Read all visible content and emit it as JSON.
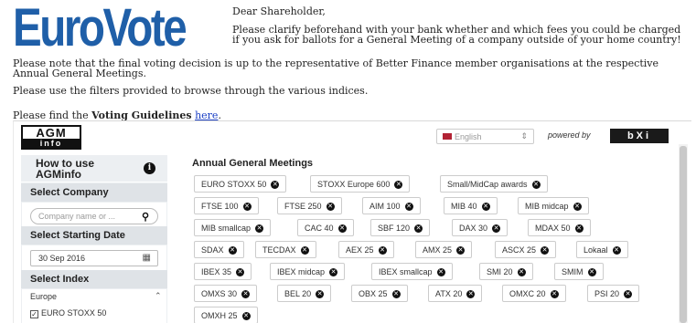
{
  "header": {
    "logo_text": "EuroVote",
    "greeting": "Dear Shareholder,",
    "notice": "Please clarify beforehand with your bank whether and which fees you could be charged if you ask for ballots for a General Meeting of a company outside of your home country!"
  },
  "body_text": {
    "p1": "Please note that the final voting decision is up to the representative of Better Finance member organisations at the respective Annual General Meetings.",
    "p2": "Please use the filters provided to browse through the various indices.",
    "p3_prefix": "Please find the ",
    "p3_bold": "Voting Guidelines",
    "p3_link": "here",
    "p3_suffix": "."
  },
  "widget": {
    "agm_logo_top": "AGM",
    "agm_logo_bottom": "info",
    "language": "English",
    "powered_by": "powered by",
    "partner_logo": "bXi",
    "sidebar": {
      "how_to": "How to use AGMinfo",
      "select_company": "Select Company",
      "company_placeholder": "Company name or ...",
      "select_date": "Select Starting Date",
      "date_value": "30 Sep 2016",
      "select_index": "Select Index",
      "region": "Europe",
      "first_index": "EURO STOXX 50"
    },
    "main_title": "Annual General Meetings",
    "chips": [
      "EURO STOXX 50",
      "STOXX Europe 600",
      "Small/MidCap awards",
      "FTSE 100",
      "FTSE 250",
      "AIM 100",
      "MIB 40",
      "MIB midcap",
      "MIB smallcap",
      "CAC 40",
      "SBF 120",
      "DAX 30",
      "MDAX 50",
      "SDAX",
      "TECDAX",
      "AEX 25",
      "AMX 25",
      "ASCX 25",
      "Lokaal",
      "IBEX 35",
      "IBEX midcap",
      "IBEX smallcap",
      "SMI 20",
      "SMIM",
      "OMXS 30",
      "BEL 20",
      "OBX 25",
      "ATX 20",
      "OMXC 20",
      "PSI 20",
      "OMXH 25"
    ]
  }
}
